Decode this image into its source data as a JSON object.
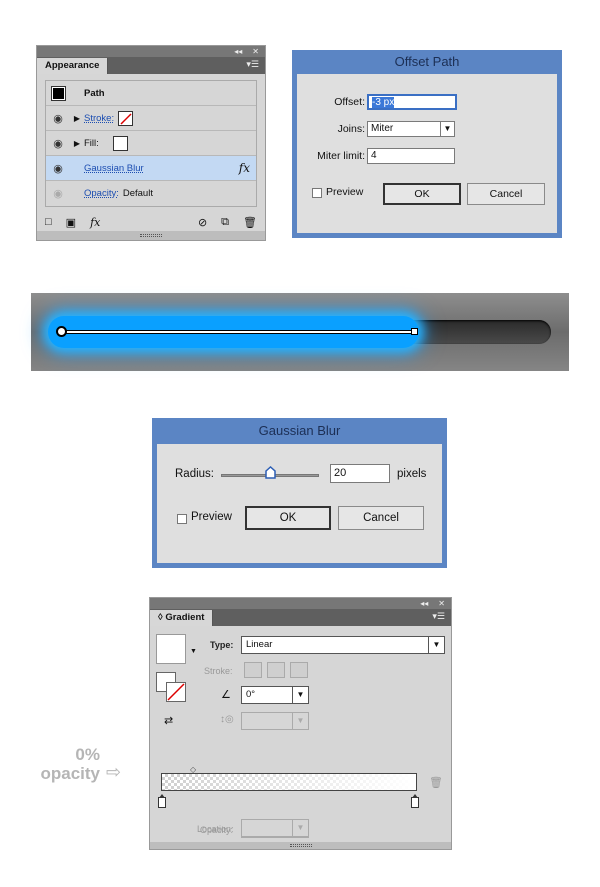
{
  "appearance": {
    "tab_label": "Appearance",
    "rows": [
      {
        "label": "Path"
      },
      {
        "label": "Stroke:"
      },
      {
        "label": "Fill:"
      },
      {
        "label": "Gaussian Blur",
        "fx": "fx"
      },
      {
        "label": "Opacity:",
        "value": "Default"
      }
    ],
    "fx_footer": "fx"
  },
  "offset_dialog": {
    "title": "Offset Path",
    "offset_label": "Offset:",
    "offset_value": "-3 px",
    "joins_label": "Joins:",
    "joins_value": "Miter",
    "miter_label": "Miter limit:",
    "miter_value": "4",
    "preview_label": "Preview",
    "ok_label": "OK",
    "cancel_label": "Cancel"
  },
  "gaussian_dialog": {
    "title": "Gaussian Blur",
    "radius_label": "Radius:",
    "radius_value": "20",
    "radius_unit": "pixels",
    "slider_fraction": 0.5,
    "preview_label": "Preview",
    "ok_label": "OK",
    "cancel_label": "Cancel"
  },
  "glow_strip": {
    "glow_color": "#0aa0ff",
    "fill_fraction": 0.74
  },
  "gradient_panel": {
    "tab_label": "Gradient",
    "type_label": "Type:",
    "type_value": "Linear",
    "stroke_label": "Stroke:",
    "angle_value": "0°",
    "opacity_label": "Opacity:",
    "location_label": "Location:"
  },
  "annotation": {
    "line1": "0%",
    "line2": "opacity",
    "arrow": "⇨"
  }
}
